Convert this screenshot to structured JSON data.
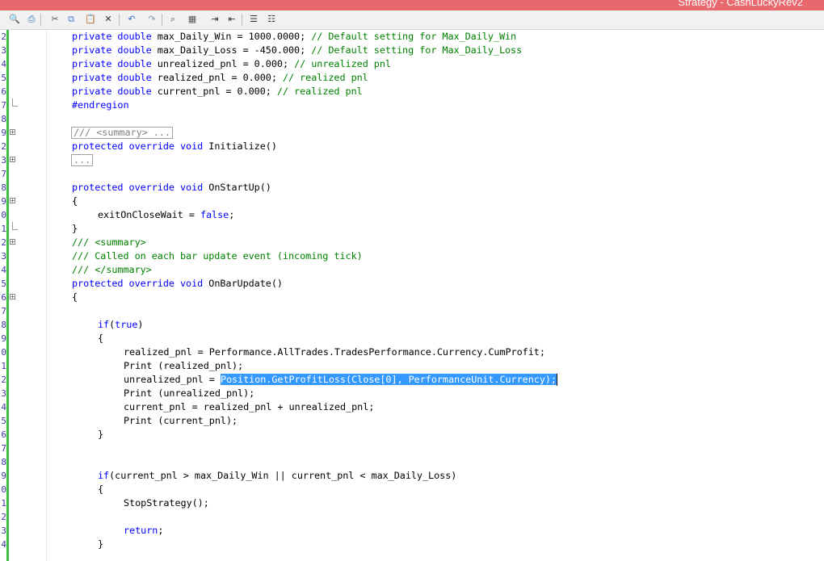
{
  "window": {
    "title": "Strategy - CashLuckyRev2"
  },
  "toolbar": {
    "buttons": [
      {
        "name": "print-preview-icon",
        "glyph": "🔍"
      },
      {
        "name": "print-icon",
        "glyph": "⎙"
      },
      {
        "name": "cut-icon",
        "glyph": "✂"
      },
      {
        "name": "copy-icon",
        "glyph": "⧉"
      },
      {
        "name": "paste-icon",
        "glyph": "📋"
      },
      {
        "name": "delete-icon",
        "glyph": "✕"
      },
      {
        "name": "undo-icon",
        "glyph": "↶"
      },
      {
        "name": "redo-icon",
        "glyph": "↷"
      },
      {
        "name": "find-icon",
        "glyph": "⌕"
      },
      {
        "name": "replace-icon",
        "glyph": "▦"
      },
      {
        "name": "indent-icon",
        "glyph": "⇥"
      },
      {
        "name": "outdent-icon",
        "glyph": "⇤"
      },
      {
        "name": "comment-icon",
        "glyph": "☰"
      },
      {
        "name": "uncomment-icon",
        "glyph": "☷"
      }
    ]
  },
  "editor": {
    "lines": [
      {
        "n": "2",
        "indent": 2,
        "tokens": [
          [
            "kw",
            "private double "
          ],
          [
            "st",
            "max_Daily_Win = 1000.0000; "
          ],
          [
            "cm",
            "// Default setting for Max_Daily_Win"
          ]
        ]
      },
      {
        "n": "3",
        "indent": 2,
        "tokens": [
          [
            "kw",
            "private double "
          ],
          [
            "st",
            "max_Daily_Loss = -450.000; "
          ],
          [
            "cm",
            "// Default setting for Max_Daily_Loss"
          ]
        ]
      },
      {
        "n": "4",
        "indent": 2,
        "tokens": [
          [
            "kw",
            "private double "
          ],
          [
            "st",
            "unrealized_pnl = 0.000; "
          ],
          [
            "cm",
            "// unrealized pnl"
          ]
        ]
      },
      {
        "n": "5",
        "indent": 2,
        "tokens": [
          [
            "kw",
            "private double "
          ],
          [
            "st",
            "realized_pnl = 0.000; "
          ],
          [
            "cm",
            "// realized pnl"
          ]
        ]
      },
      {
        "n": "6",
        "indent": 2,
        "tokens": [
          [
            "kw",
            "private double "
          ],
          [
            "st",
            "current_pnl = 0.000; "
          ],
          [
            "cm",
            "// realized pnl"
          ]
        ]
      },
      {
        "n": "7",
        "indent": 2,
        "fold": "end",
        "tokens": [
          [
            "pp",
            "#endregion"
          ]
        ]
      },
      {
        "n": "8",
        "indent": 2,
        "tokens": []
      },
      {
        "n": "9",
        "indent": 2,
        "fold": "box",
        "tokens": [
          [
            "collapsed",
            "/// <summary> ..."
          ]
        ]
      },
      {
        "n": "2",
        "indent": 2,
        "tokens": [
          [
            "kw",
            "protected override void "
          ],
          [
            "st",
            "Initialize()"
          ]
        ]
      },
      {
        "n": "3",
        "indent": 2,
        "fold": "box",
        "tokens": [
          [
            "collapsed",
            "..."
          ]
        ]
      },
      {
        "n": "7",
        "indent": 2,
        "tokens": []
      },
      {
        "n": "8",
        "indent": 2,
        "tokens": [
          [
            "kw",
            "protected override void "
          ],
          [
            "st",
            "OnStartUp()"
          ]
        ]
      },
      {
        "n": "9",
        "indent": 2,
        "fold": "box",
        "tokens": [
          [
            "st",
            "{"
          ]
        ]
      },
      {
        "n": "0",
        "indent": 3,
        "tokens": [
          [
            "st",
            "exitOnCloseWait = "
          ],
          [
            "kw",
            "false"
          ],
          [
            "st",
            ";"
          ]
        ]
      },
      {
        "n": "1",
        "indent": 2,
        "fold": "end",
        "tokens": [
          [
            "st",
            "}"
          ]
        ]
      },
      {
        "n": "2",
        "indent": 2,
        "fold": "box",
        "tokens": [
          [
            "cm",
            "/// <summary>"
          ]
        ]
      },
      {
        "n": "3",
        "indent": 2,
        "tokens": [
          [
            "cm",
            "/// Called on each bar update event (incoming tick)"
          ]
        ]
      },
      {
        "n": "4",
        "indent": 2,
        "tokens": [
          [
            "cm",
            "/// </summary>"
          ]
        ]
      },
      {
        "n": "5",
        "indent": 2,
        "tokens": [
          [
            "kw",
            "protected override void "
          ],
          [
            "st",
            "OnBarUpdate()"
          ]
        ]
      },
      {
        "n": "6",
        "indent": 2,
        "fold": "box",
        "tokens": [
          [
            "st",
            "{"
          ]
        ]
      },
      {
        "n": "7",
        "indent": 3,
        "tokens": []
      },
      {
        "n": "8",
        "indent": 3,
        "tokens": [
          [
            "kw",
            "if"
          ],
          [
            "st",
            "("
          ],
          [
            "kw",
            "true"
          ],
          [
            "st",
            ")"
          ]
        ]
      },
      {
        "n": "9",
        "indent": 3,
        "tokens": [
          [
            "st",
            "{"
          ]
        ]
      },
      {
        "n": "0",
        "indent": 4,
        "tokens": [
          [
            "st",
            "realized_pnl = Performance.AllTrades.TradesPerformance.Currency.CumProfit;"
          ]
        ]
      },
      {
        "n": "1",
        "indent": 4,
        "tokens": [
          [
            "st",
            "Print (realized_pnl);"
          ]
        ]
      },
      {
        "n": "2",
        "indent": 4,
        "tokens": [
          [
            "st",
            "unrealized_pnl = "
          ],
          [
            "sel",
            "Position.GetProfitLoss(Close[0], PerformanceUnit.Currency);"
          ]
        ]
      },
      {
        "n": "3",
        "indent": 4,
        "tokens": [
          [
            "st",
            "Print (unrealized_pnl);"
          ]
        ]
      },
      {
        "n": "4",
        "indent": 4,
        "tokens": [
          [
            "st",
            "current_pnl = realized_pnl + unrealized_pnl;"
          ]
        ]
      },
      {
        "n": "5",
        "indent": 4,
        "tokens": [
          [
            "st",
            "Print (current_pnl);"
          ]
        ]
      },
      {
        "n": "6",
        "indent": 3,
        "tokens": [
          [
            "st",
            "}"
          ]
        ]
      },
      {
        "n": "7",
        "indent": 3,
        "tokens": []
      },
      {
        "n": "8",
        "indent": 3,
        "tokens": []
      },
      {
        "n": "9",
        "indent": 3,
        "tokens": [
          [
            "kw",
            "if"
          ],
          [
            "st",
            "(current_pnl > max_Daily_Win || current_pnl < max_Daily_Loss)"
          ]
        ]
      },
      {
        "n": "0",
        "indent": 3,
        "tokens": [
          [
            "st",
            "{"
          ]
        ]
      },
      {
        "n": "1",
        "indent": 4,
        "tokens": [
          [
            "st",
            "StopStrategy();"
          ]
        ]
      },
      {
        "n": "2",
        "indent": 4,
        "tokens": []
      },
      {
        "n": "3",
        "indent": 4,
        "tokens": [
          [
            "kw",
            "return"
          ],
          [
            "st",
            ";"
          ]
        ]
      },
      {
        "n": "4",
        "indent": 3,
        "tokens": [
          [
            "st",
            "}"
          ]
        ]
      }
    ]
  }
}
